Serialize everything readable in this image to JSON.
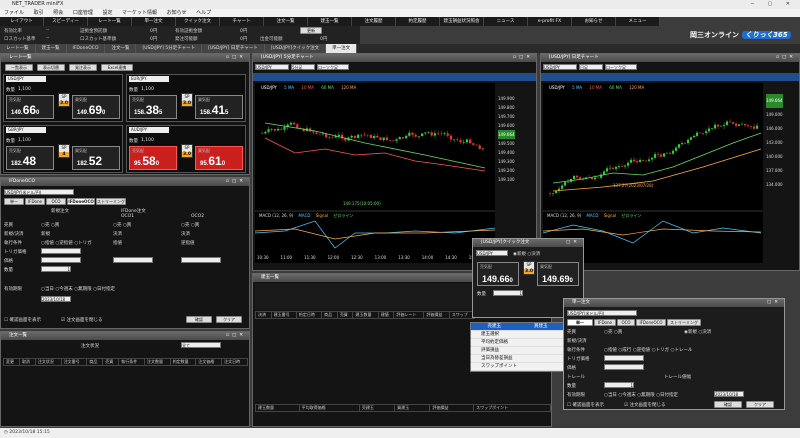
{
  "window": {
    "title": "NET_TRADER miniFX"
  },
  "menubar": [
    "ファイル",
    "取引",
    "照会",
    "口座管理",
    "設定",
    "マーケット情報",
    "お知らせ",
    "ヘルプ"
  ],
  "toolbar": [
    "レイアウト",
    "スピーディー",
    "レート一覧",
    "単一注文",
    "クイック注文",
    "チャート",
    "注文一覧",
    "建玉一覧",
    "注文履歴",
    "約定履歴",
    "建玉損益状況照会",
    "ニュース",
    "e-profit FX",
    "お知らせ",
    "メニュー"
  ],
  "account": {
    "row1": [
      "有効比率",
      "--",
      "証拠金預託額",
      "0円",
      "有効証拠金額",
      "0円",
      "更新"
    ],
    "row2": [
      "ロスカット基準",
      "--",
      "ロスカット基準額",
      "0円",
      "発注可能額",
      "0円",
      "出金可能額",
      "0円"
    ]
  },
  "logo": {
    "brand": "岡三オンライン",
    "badge": "くりっく365"
  },
  "tabs": [
    {
      "label": "レート一覧",
      "active": false
    },
    {
      "label": "建玉一覧",
      "active": false
    },
    {
      "label": "IFDoneOCO",
      "active": false
    },
    {
      "label": "注文一覧",
      "active": false
    },
    {
      "label": "[USD/JPY] 5分足チャート",
      "active": false
    },
    {
      "label": "[USD/JPY] 日足チャート",
      "active": false
    },
    {
      "label": "[USD/JPY]クイック注文",
      "active": false
    },
    {
      "label": "単一注文",
      "active": true
    }
  ],
  "rate_panel": {
    "title": "レート一覧",
    "buttons": [
      "一覧表示",
      "表示切替",
      "発注表示",
      "Excel連携"
    ],
    "tiles": [
      {
        "pair": "USD/JPY",
        "sell_label": "売気配",
        "buy_label": "買気配",
        "sell_int": "149.",
        "sell_big": "66",
        "sell_frac": "0",
        "buy_int": "149.",
        "buy_big": "69",
        "buy_frac": "0",
        "sp": "3.0",
        "red": false
      },
      {
        "pair": "EUR/JPY",
        "sell_label": "売気配",
        "buy_label": "買気配",
        "sell_int": "158.",
        "sell_big": "38",
        "sell_frac": "5",
        "buy_int": "158.",
        "buy_big": "41",
        "buy_frac": "5",
        "sp": "3.0",
        "red": false
      },
      {
        "pair": "GBP/JPY",
        "sell_label": "売気配",
        "buy_label": "買気配",
        "sell_int": "182.",
        "sell_big": "48",
        "sell_frac": "",
        "buy_int": "182.",
        "buy_big": "52",
        "buy_frac": "",
        "sp": "4",
        "red": false
      },
      {
        "pair": "AUD/JPY",
        "sell_label": "売気配",
        "buy_label": "買気配",
        "sell_int": "95.",
        "sell_big": "58",
        "sell_frac": "0",
        "buy_int": "95.",
        "buy_big": "61",
        "buy_frac": "0",
        "sp": "3.0",
        "red": true
      }
    ],
    "qty_label": "数量",
    "qty_value": "1,100"
  },
  "ifdoco": {
    "title": "IFDoneOCO",
    "pair": "USD/JPY(米ドル/円)",
    "tabs": [
      "単一",
      "IFDone",
      "OCO",
      "IFDoneOCO",
      "ストリーミング"
    ],
    "headers": [
      "新規注文",
      "IFDone注文",
      "OCO1",
      "OCO2"
    ],
    "rows": [
      "売買",
      "新規/決済",
      "執行条件",
      "トリガ価格",
      "価格",
      "数量",
      "有効期限"
    ],
    "side": [
      "売",
      "買"
    ],
    "open_close": "新規",
    "settle": "決済",
    "exec": [
      "指値",
      "逆指値",
      "トリガ"
    ],
    "limit": "指値",
    "stop": "逆指値",
    "qty": "1",
    "expiry": [
      "当日",
      "今週末",
      "無期限",
      "日付指定"
    ],
    "date": "2023/10/18",
    "clear": "クリア",
    "confirm": "確認",
    "confirm_option": "確認画面を表示",
    "skip_option": "注文画面を閉じる"
  },
  "order_list": {
    "title": "注文一覧",
    "filter_label": "注文状況",
    "filter_value": "全て",
    "columns": [
      "変更",
      "取消",
      "注文状況",
      "注文番号",
      "商品",
      "売買",
      "執行条件",
      "注文数量",
      "約定数量",
      "注文価格",
      "注文日時"
    ]
  },
  "chart5": {
    "title": "[USD/JPY] 5分足チャート",
    "pair": "USD/JPY",
    "timeframe": "5分足",
    "chart_style": "ローソク足",
    "legend": [
      "USD/JPY",
      "5 MA",
      "10 MA",
      "60 MA",
      "120 MA"
    ],
    "prices": [
      "149.900",
      "149.800",
      "149.700",
      "149.600",
      "149.500",
      "149.400",
      "149.300",
      "149.200",
      "149.100"
    ],
    "last": "149.664",
    "times": [
      "10:30",
      "11:00",
      "11:30",
      "12:00",
      "12:30",
      "13:00",
      "13:30",
      "14:00",
      "14:30",
      "15:00"
    ],
    "low_label": "149.175(10:05:00)",
    "macd_legend": [
      "MACD (12, 26, 9)",
      "MACD",
      "Signal",
      "ゼロライン"
    ]
  },
  "chartD": {
    "title": "[USD/JPY] 日足チャート",
    "pair": "USD/JPY",
    "timeframe": "日足",
    "chart_style": "ローソク足",
    "legend": [
      "USD/JPY",
      "5 MA",
      "10 MA",
      "60 MA",
      "120 MA"
    ],
    "prices": [
      "149.000",
      "146.000",
      "143.000",
      "140.000",
      "137.000",
      "134.000"
    ],
    "last": "149.664",
    "low_label": "137.27(2023/07/28)",
    "macd_legend": [
      "MACD (12, 26, 9)",
      "MACD",
      "Signal",
      "ゼロライン"
    ]
  },
  "positions": {
    "title": "建玉一覧",
    "columns": [
      "決済",
      "建玉番号",
      "約定日時",
      "商品",
      "売買",
      "建玉数量",
      "建値",
      "評価レート",
      "評価損益",
      "スワップ"
    ],
    "summary": [
      "建玉数量",
      "平均取得価格",
      "売建玉",
      "買建玉",
      "評価損益",
      "スワップポイント"
    ]
  },
  "quick": {
    "title": "[USD/JPY]クイック注文",
    "pair": "USD/JPY",
    "mode_new": "新規",
    "mode_settle": "決済",
    "sell_label": "売気配",
    "buy_label": "買気配",
    "sell_price": "149.66",
    "sell_frac": "0",
    "buy_price": "149.69",
    "buy_frac": "0",
    "sp": "3.0",
    "qty_label": "数量",
    "qty": "1"
  },
  "context_menu": {
    "header": [
      "売建玉",
      "買建玉"
    ],
    "items": [
      "建玉選択",
      "平均約定価格",
      "評価損益",
      "当日為替差損益",
      "スワップポイント"
    ]
  },
  "single": {
    "title": "単一注文",
    "pair": "USD/JPY(米ドル/円)",
    "tabs": [
      "単一",
      "IFDone",
      "OCO",
      "IFDoneOCO",
      "ストリーミング"
    ],
    "rows": [
      "売買",
      "新規/決済",
      "執行条件",
      "トリガ価格",
      "価格",
      "トレール",
      "数量",
      "有効期限"
    ],
    "side": [
      "売",
      "買"
    ],
    "new": "新規",
    "settle": "決済",
    "exec": [
      "指値",
      "成行",
      "逆指値",
      "トリガ",
      "トレール"
    ],
    "trail_label": "トレール値幅",
    "qty": "1",
    "expiry": [
      "当日",
      "今週末",
      "無期限",
      "日付指定"
    ],
    "date": "2023/10/18",
    "clear": "クリア",
    "confirm": "確認",
    "confirm_option": "確認画面を表示",
    "skip_option": "注文画面を閉じる"
  },
  "status": {
    "datetime": "2023/10/18 15:15"
  }
}
